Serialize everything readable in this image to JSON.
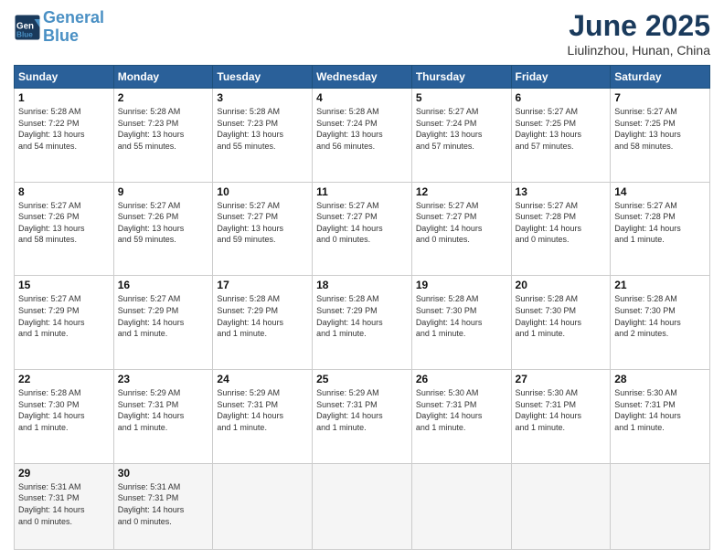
{
  "header": {
    "logo_line1": "General",
    "logo_line2": "Blue",
    "month": "June 2025",
    "location": "Liulinzhou, Hunan, China"
  },
  "days_of_week": [
    "Sunday",
    "Monday",
    "Tuesday",
    "Wednesday",
    "Thursday",
    "Friday",
    "Saturday"
  ],
  "weeks": [
    [
      {
        "day": "1",
        "lines": [
          "Sunrise: 5:28 AM",
          "Sunset: 7:22 PM",
          "Daylight: 13 hours",
          "and 54 minutes."
        ]
      },
      {
        "day": "2",
        "lines": [
          "Sunrise: 5:28 AM",
          "Sunset: 7:23 PM",
          "Daylight: 13 hours",
          "and 55 minutes."
        ]
      },
      {
        "day": "3",
        "lines": [
          "Sunrise: 5:28 AM",
          "Sunset: 7:23 PM",
          "Daylight: 13 hours",
          "and 55 minutes."
        ]
      },
      {
        "day": "4",
        "lines": [
          "Sunrise: 5:28 AM",
          "Sunset: 7:24 PM",
          "Daylight: 13 hours",
          "and 56 minutes."
        ]
      },
      {
        "day": "5",
        "lines": [
          "Sunrise: 5:27 AM",
          "Sunset: 7:24 PM",
          "Daylight: 13 hours",
          "and 57 minutes."
        ]
      },
      {
        "day": "6",
        "lines": [
          "Sunrise: 5:27 AM",
          "Sunset: 7:25 PM",
          "Daylight: 13 hours",
          "and 57 minutes."
        ]
      },
      {
        "day": "7",
        "lines": [
          "Sunrise: 5:27 AM",
          "Sunset: 7:25 PM",
          "Daylight: 13 hours",
          "and 58 minutes."
        ]
      }
    ],
    [
      {
        "day": "8",
        "lines": [
          "Sunrise: 5:27 AM",
          "Sunset: 7:26 PM",
          "Daylight: 13 hours",
          "and 58 minutes."
        ]
      },
      {
        "day": "9",
        "lines": [
          "Sunrise: 5:27 AM",
          "Sunset: 7:26 PM",
          "Daylight: 13 hours",
          "and 59 minutes."
        ]
      },
      {
        "day": "10",
        "lines": [
          "Sunrise: 5:27 AM",
          "Sunset: 7:27 PM",
          "Daylight: 13 hours",
          "and 59 minutes."
        ]
      },
      {
        "day": "11",
        "lines": [
          "Sunrise: 5:27 AM",
          "Sunset: 7:27 PM",
          "Daylight: 14 hours",
          "and 0 minutes."
        ]
      },
      {
        "day": "12",
        "lines": [
          "Sunrise: 5:27 AM",
          "Sunset: 7:27 PM",
          "Daylight: 14 hours",
          "and 0 minutes."
        ]
      },
      {
        "day": "13",
        "lines": [
          "Sunrise: 5:27 AM",
          "Sunset: 7:28 PM",
          "Daylight: 14 hours",
          "and 0 minutes."
        ]
      },
      {
        "day": "14",
        "lines": [
          "Sunrise: 5:27 AM",
          "Sunset: 7:28 PM",
          "Daylight: 14 hours",
          "and 1 minute."
        ]
      }
    ],
    [
      {
        "day": "15",
        "lines": [
          "Sunrise: 5:27 AM",
          "Sunset: 7:29 PM",
          "Daylight: 14 hours",
          "and 1 minute."
        ]
      },
      {
        "day": "16",
        "lines": [
          "Sunrise: 5:27 AM",
          "Sunset: 7:29 PM",
          "Daylight: 14 hours",
          "and 1 minute."
        ]
      },
      {
        "day": "17",
        "lines": [
          "Sunrise: 5:28 AM",
          "Sunset: 7:29 PM",
          "Daylight: 14 hours",
          "and 1 minute."
        ]
      },
      {
        "day": "18",
        "lines": [
          "Sunrise: 5:28 AM",
          "Sunset: 7:29 PM",
          "Daylight: 14 hours",
          "and 1 minute."
        ]
      },
      {
        "day": "19",
        "lines": [
          "Sunrise: 5:28 AM",
          "Sunset: 7:30 PM",
          "Daylight: 14 hours",
          "and 1 minute."
        ]
      },
      {
        "day": "20",
        "lines": [
          "Sunrise: 5:28 AM",
          "Sunset: 7:30 PM",
          "Daylight: 14 hours",
          "and 1 minute."
        ]
      },
      {
        "day": "21",
        "lines": [
          "Sunrise: 5:28 AM",
          "Sunset: 7:30 PM",
          "Daylight: 14 hours",
          "and 2 minutes."
        ]
      }
    ],
    [
      {
        "day": "22",
        "lines": [
          "Sunrise: 5:28 AM",
          "Sunset: 7:30 PM",
          "Daylight: 14 hours",
          "and 1 minute."
        ]
      },
      {
        "day": "23",
        "lines": [
          "Sunrise: 5:29 AM",
          "Sunset: 7:31 PM",
          "Daylight: 14 hours",
          "and 1 minute."
        ]
      },
      {
        "day": "24",
        "lines": [
          "Sunrise: 5:29 AM",
          "Sunset: 7:31 PM",
          "Daylight: 14 hours",
          "and 1 minute."
        ]
      },
      {
        "day": "25",
        "lines": [
          "Sunrise: 5:29 AM",
          "Sunset: 7:31 PM",
          "Daylight: 14 hours",
          "and 1 minute."
        ]
      },
      {
        "day": "26",
        "lines": [
          "Sunrise: 5:30 AM",
          "Sunset: 7:31 PM",
          "Daylight: 14 hours",
          "and 1 minute."
        ]
      },
      {
        "day": "27",
        "lines": [
          "Sunrise: 5:30 AM",
          "Sunset: 7:31 PM",
          "Daylight: 14 hours",
          "and 1 minute."
        ]
      },
      {
        "day": "28",
        "lines": [
          "Sunrise: 5:30 AM",
          "Sunset: 7:31 PM",
          "Daylight: 14 hours",
          "and 1 minute."
        ]
      }
    ],
    [
      {
        "day": "29",
        "lines": [
          "Sunrise: 5:31 AM",
          "Sunset: 7:31 PM",
          "Daylight: 14 hours",
          "and 0 minutes."
        ]
      },
      {
        "day": "30",
        "lines": [
          "Sunrise: 5:31 AM",
          "Sunset: 7:31 PM",
          "Daylight: 14 hours",
          "and 0 minutes."
        ]
      },
      {
        "day": "",
        "lines": []
      },
      {
        "day": "",
        "lines": []
      },
      {
        "day": "",
        "lines": []
      },
      {
        "day": "",
        "lines": []
      },
      {
        "day": "",
        "lines": []
      }
    ]
  ]
}
